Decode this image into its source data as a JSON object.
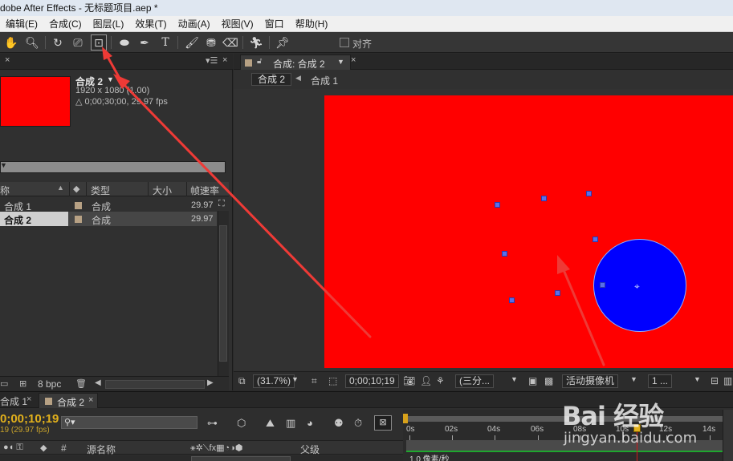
{
  "window": {
    "title": "dobe After Effects - 无标题项目.aep *"
  },
  "menu": [
    "编辑(E)",
    "合成(C)",
    "图层(L)",
    "效果(T)",
    "动画(A)",
    "视图(V)",
    "窗口",
    "帮助(H)"
  ],
  "toolbar": {
    "snap_label": "对齐"
  },
  "project": {
    "comp_name": "合成 2",
    "comp_size": "1920 x 1080 (1.00)",
    "comp_duration": "△ 0;00;30;00, 29.97 fps",
    "columns": {
      "name": "称",
      "type": "类型",
      "size": "大小",
      "fps": "帧速率"
    },
    "items": [
      {
        "name": "合成 1",
        "type": "合成",
        "fps": "29.97"
      },
      {
        "name": "合成 2",
        "type": "合成",
        "fps": "29.97"
      }
    ],
    "bpc": "8 bpc"
  },
  "composition": {
    "tab_label": "合成: 合成 2",
    "nav_active": "合成 2",
    "nav_other": "合成 1",
    "zoom": "(31.7%)",
    "timecode": "0;00;10;19",
    "resolution": "(三分...",
    "camera": "活动摄像机",
    "views": "1 ..."
  },
  "timeline": {
    "tab_1": "合成 1",
    "tab_2": "合成 2",
    "timecode": "0;00;10;19",
    "fps_sub": "19 (29.97 fps)",
    "layer_col_source": "源名称",
    "layer_col_parent": "父级",
    "ruler_ticks": [
      "0s",
      "02s",
      "04s",
      "06s",
      "08s",
      "10s",
      "12s",
      "14s"
    ],
    "rate_label": "1.0 像素/秒"
  },
  "watermark": {
    "brand": "Bai 经验",
    "sub": "jingyan.baidu.com"
  },
  "colors": {
    "canvas_bg": "#ff0000",
    "shape_fill": "#0000ff",
    "timecode": "#e2b11c",
    "annotation": "#ee3a36"
  }
}
